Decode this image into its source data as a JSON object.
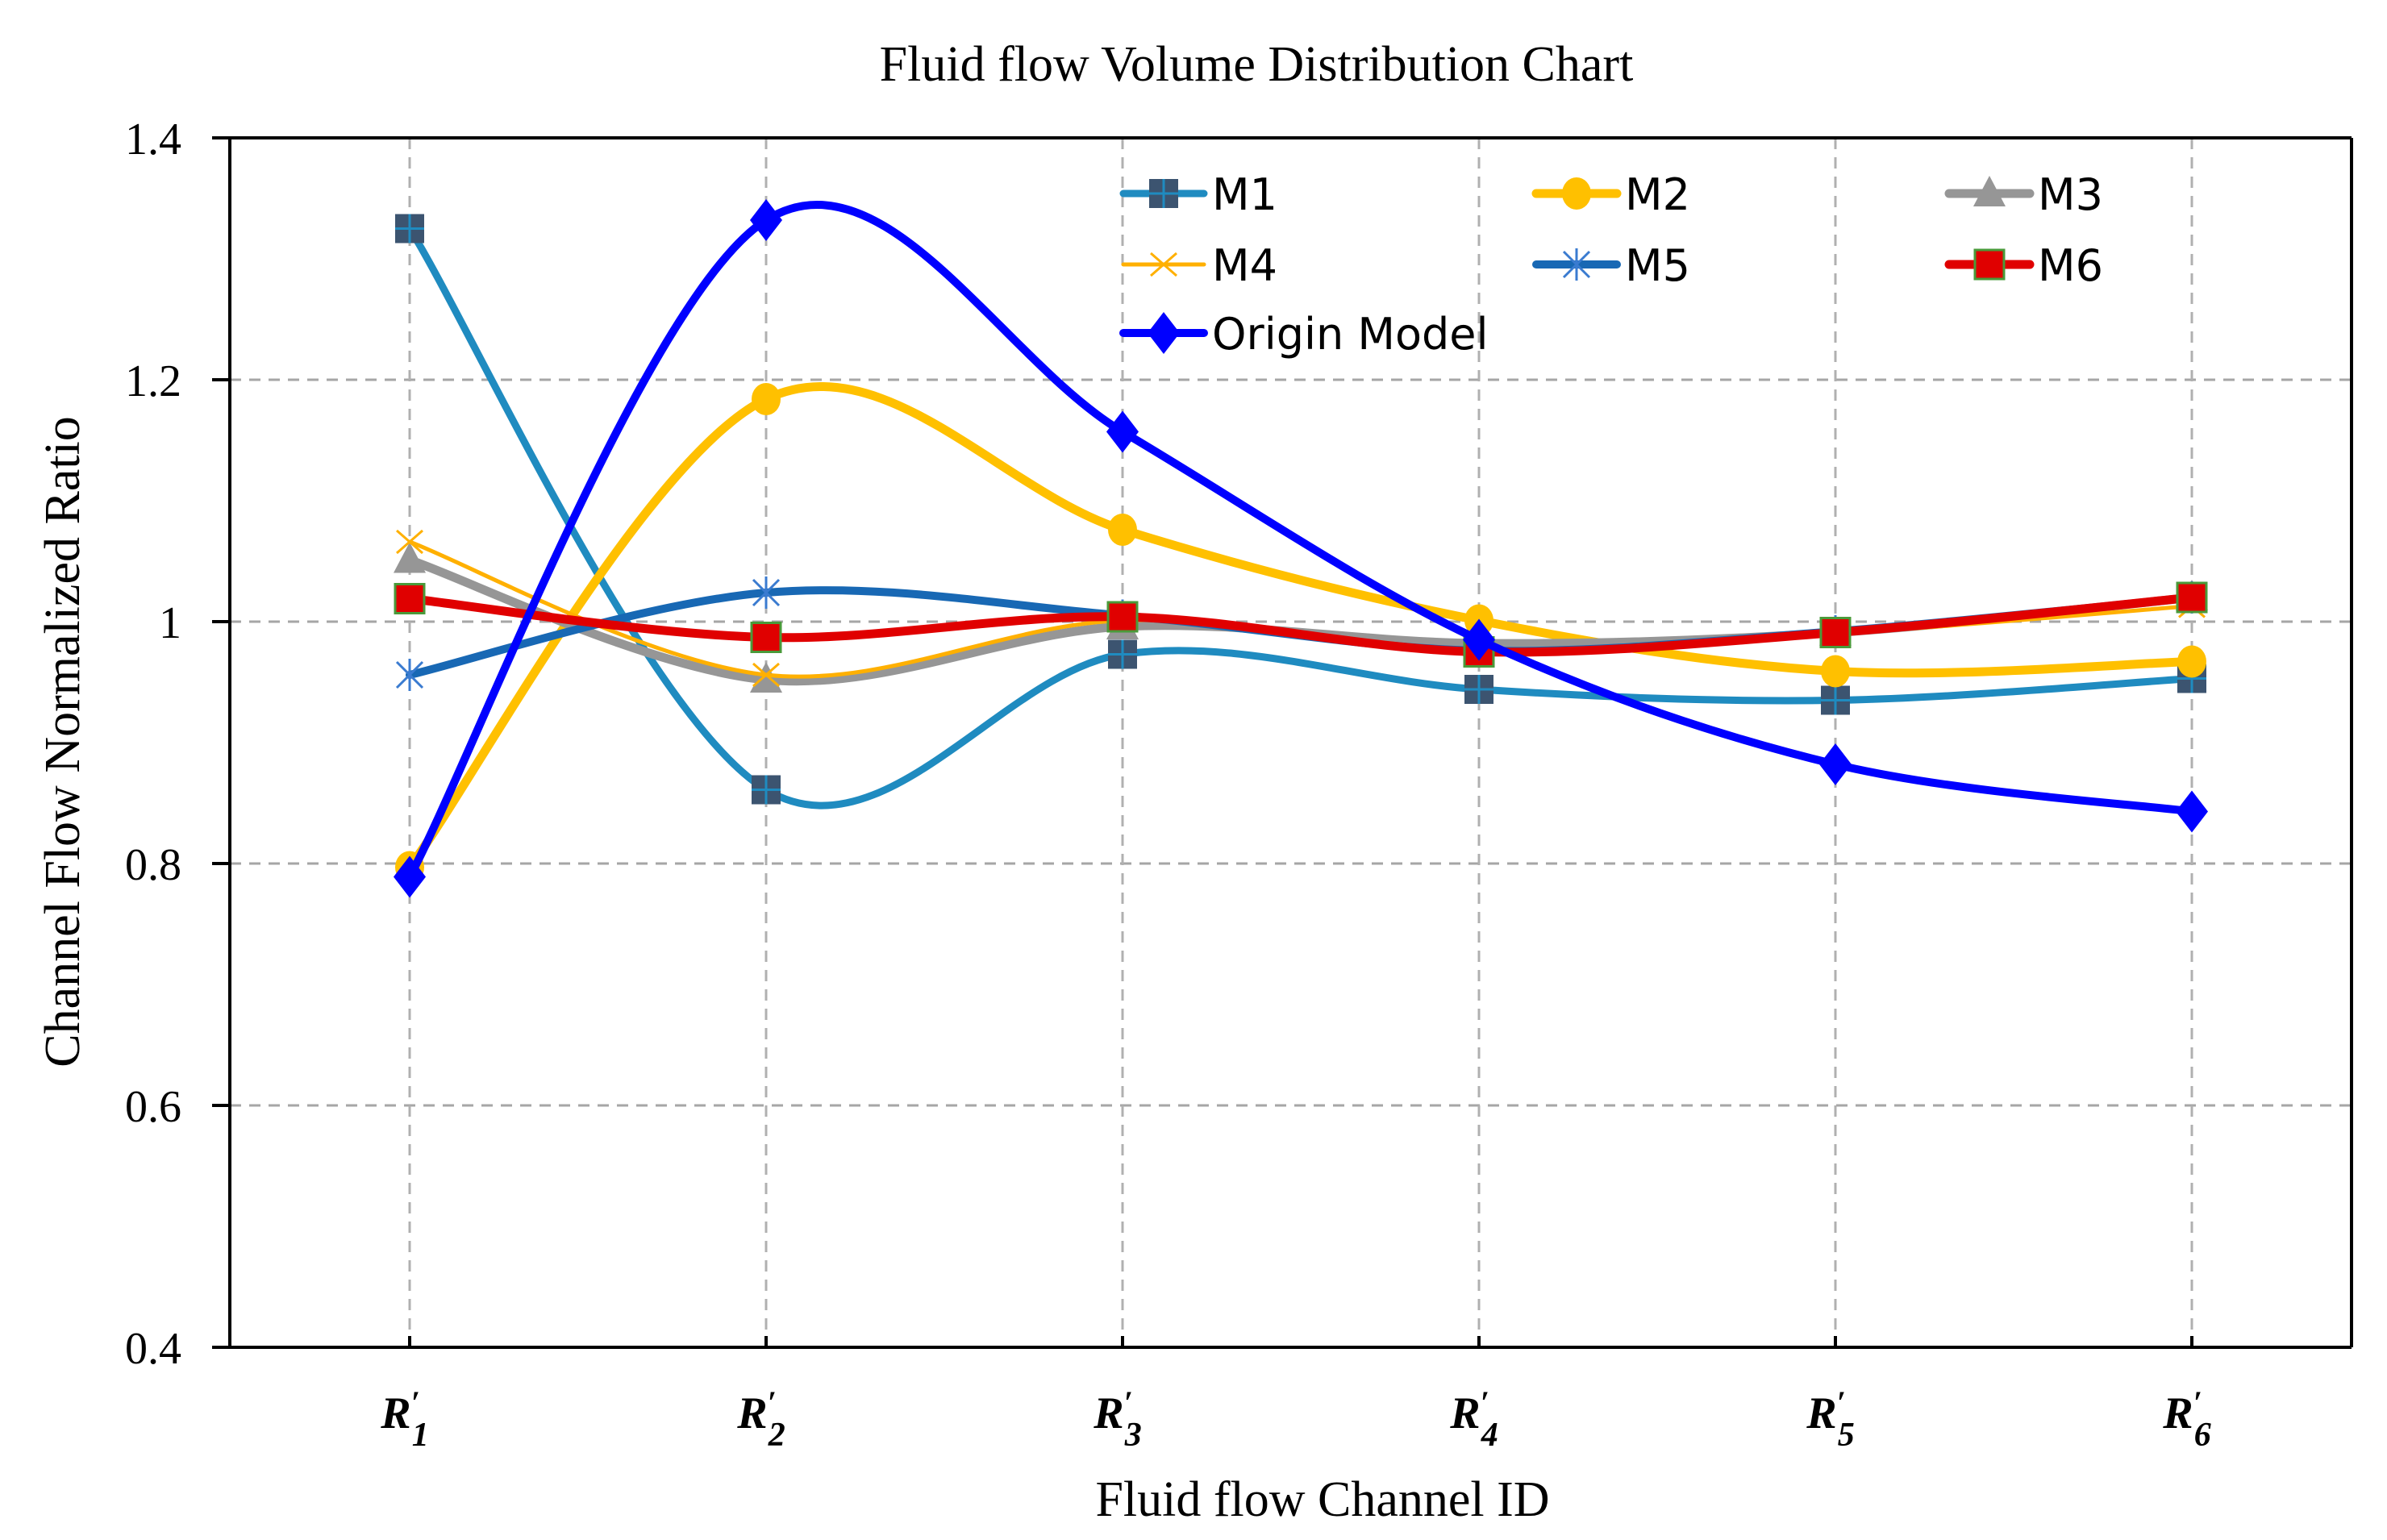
{
  "chart_data": {
    "type": "line",
    "title": "Fluid flow Volume Distribution Chart",
    "xlabel": "Fluid flow Channel ID",
    "ylabel": "Channel Flow Normalized Ratio",
    "categories": [
      "R'1",
      "R'2",
      "R'3",
      "R'4",
      "R'5",
      "R'6"
    ],
    "category_labels": [
      {
        "base": "R",
        "prime": "′",
        "sub": "1"
      },
      {
        "base": "R",
        "prime": "′",
        "sub": "2"
      },
      {
        "base": "R",
        "prime": "′",
        "sub": "3"
      },
      {
        "base": "R",
        "prime": "′",
        "sub": "4"
      },
      {
        "base": "R",
        "prime": "′",
        "sub": "5"
      },
      {
        "base": "R",
        "prime": "′",
        "sub": "6"
      }
    ],
    "ylim": [
      0.4,
      1.4
    ],
    "yticks": [
      0.4,
      0.6,
      0.8,
      1.0,
      1.2,
      1.4
    ],
    "ytick_labels": [
      "0.4",
      "0.6",
      "0.8",
      "1",
      "1.2",
      "1.4"
    ],
    "grid": true,
    "smoothed": true,
    "legend_position": "top-right",
    "series": [
      {
        "name": "M1",
        "color": "#1f8bc0",
        "marker": "square",
        "marker_color": "#3c5470",
        "values": [
          1.325,
          0.861,
          0.973,
          0.944,
          0.935,
          0.953
        ]
      },
      {
        "name": "M2",
        "color": "#ffc000",
        "marker": "circle",
        "marker_color": "#ffc000",
        "values": [
          0.797,
          1.184,
          1.076,
          1.001,
          0.959,
          0.967
        ]
      },
      {
        "name": "M3",
        "color": "#969696",
        "marker": "triangle",
        "marker_color": "#969696",
        "values": [
          1.051,
          0.952,
          0.996,
          0.982,
          0.991,
          1.02
        ]
      },
      {
        "name": "M4",
        "color": "#ffb000",
        "marker": "x",
        "marker_color": "#ffb000",
        "values": [
          1.066,
          0.956,
          1.001,
          0.977,
          0.99,
          1.013
        ]
      },
      {
        "name": "M5",
        "color": "#1868b4",
        "marker": "asterisk",
        "marker_color": "#3a7bd0",
        "values": [
          0.956,
          1.024,
          1.005,
          0.976,
          0.992,
          1.02
        ]
      },
      {
        "name": "M6",
        "color": "#e00000",
        "marker": "square",
        "marker_color": "#e00000",
        "values": [
          1.019,
          0.987,
          1.004,
          0.975,
          0.991,
          1.02
        ]
      },
      {
        "name": "Origin Model",
        "color": "#0000ff",
        "marker": "diamond",
        "marker_color": "#0000ff",
        "values": [
          0.789,
          1.332,
          1.157,
          0.985,
          0.882,
          0.843
        ]
      }
    ]
  }
}
